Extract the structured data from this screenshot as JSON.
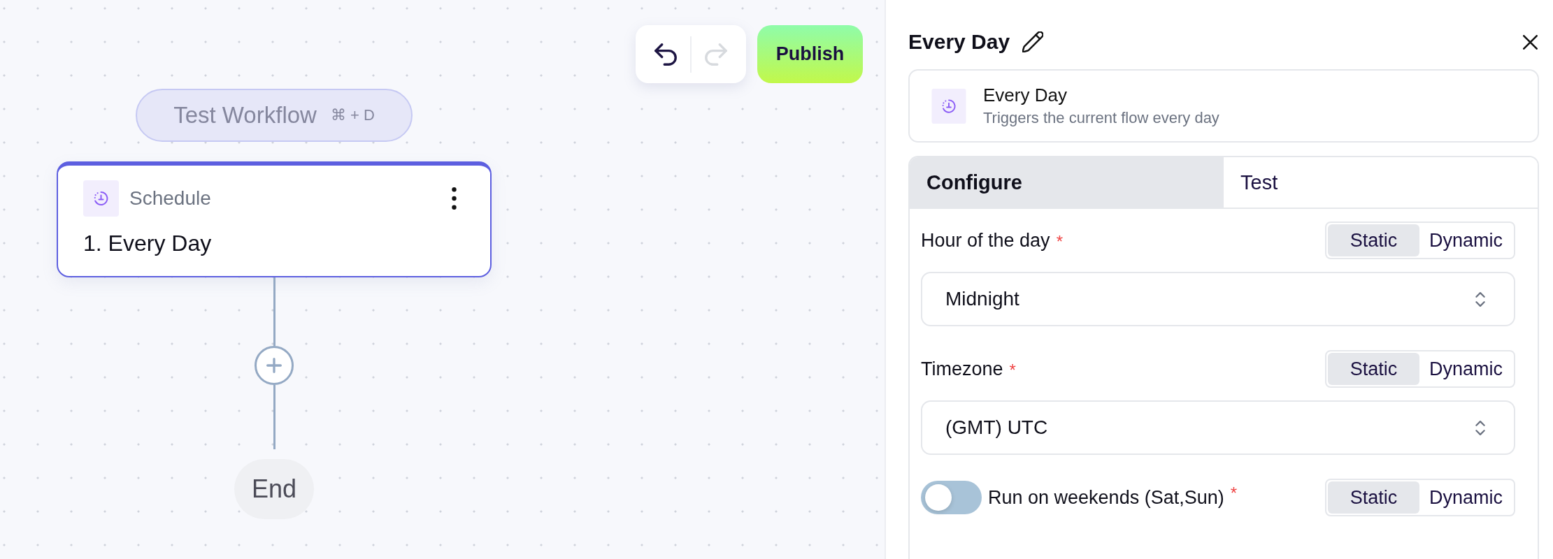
{
  "canvas": {
    "history": [
      {
        "kind": "undo",
        "disabled": false
      },
      {
        "kind": "redo",
        "disabled": true
      }
    ],
    "publish": "Publish",
    "test_button": {
      "label": "Test Workflow",
      "shortcut": "⌘ + D"
    },
    "step": {
      "app": "Schedule",
      "title": "1. Every Day",
      "selected": true
    },
    "end": "End"
  },
  "panel": {
    "title": "Every Day",
    "trigger": {
      "name": "Every Day",
      "description": "Triggers the current flow every day"
    },
    "tabs": [
      {
        "label": "Configure",
        "selected": true
      },
      {
        "label": "Test",
        "selected": false
      }
    ],
    "fields": [
      {
        "kind": "select",
        "label": "Hour of the day",
        "required_mark": "*",
        "modes": [
          {
            "label": "Static",
            "selected": true
          },
          {
            "label": "Dynamic",
            "selected": false
          }
        ],
        "value": "Midnight"
      },
      {
        "kind": "select",
        "label": "Timezone",
        "required_mark": "*",
        "modes": [
          {
            "label": "Static",
            "selected": true
          },
          {
            "label": "Dynamic",
            "selected": false
          }
        ],
        "value": "(GMT) UTC"
      },
      {
        "kind": "toggle",
        "label": "Run on weekends (Sat,Sun)",
        "required_mark": "*",
        "on": false,
        "modes": [
          {
            "label": "Static",
            "selected": true
          },
          {
            "label": "Dynamic",
            "selected": false
          }
        ]
      }
    ]
  }
}
